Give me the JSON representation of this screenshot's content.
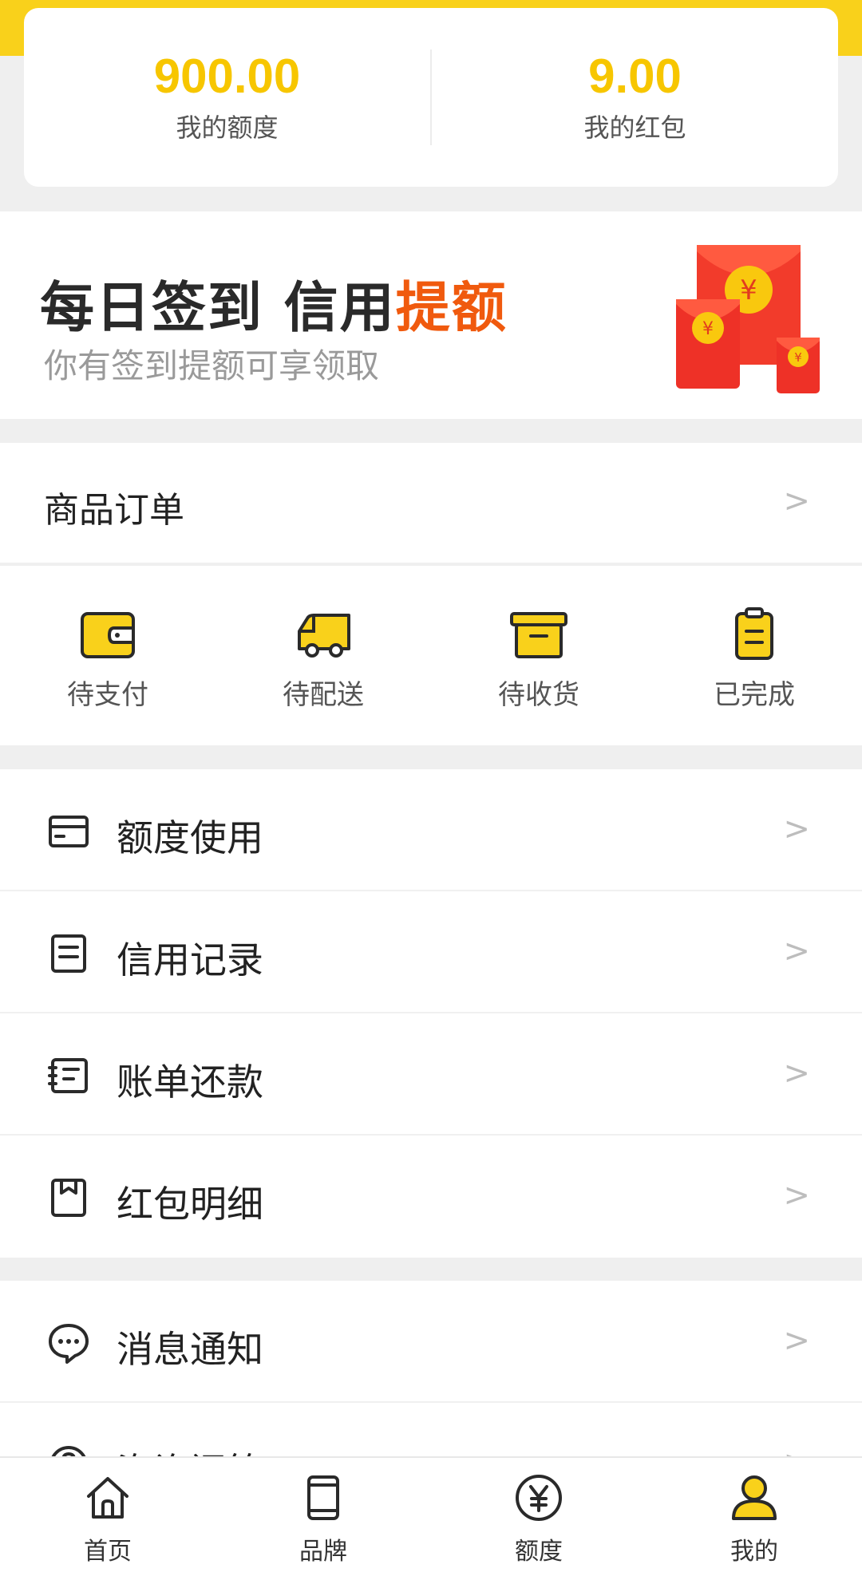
{
  "colors": {
    "brand_yellow": "#f9d11b",
    "highlight_orange": "#f05a0e"
  },
  "stats": {
    "quota_value": "900.00",
    "quota_label": "我的额度",
    "redpack_value": "9.00",
    "redpack_label": "我的红包"
  },
  "signin": {
    "title_main": "每日签到 信用",
    "title_highlight": "提额",
    "subtitle": "你有签到提额可享领取",
    "currency_symbol": "¥"
  },
  "orders": {
    "title": "商品订单",
    "chevron": ">",
    "statuses": [
      {
        "label": "待支付",
        "icon": "wallet-icon"
      },
      {
        "label": "待配送",
        "icon": "truck-icon"
      },
      {
        "label": "待收货",
        "icon": "box-icon"
      },
      {
        "label": "已完成",
        "icon": "clipboard-icon"
      }
    ]
  },
  "menu_group1": [
    {
      "label": "额度使用",
      "icon": "card-icon"
    },
    {
      "label": "信用记录",
      "icon": "document-icon"
    },
    {
      "label": "账单还款",
      "icon": "bill-icon"
    },
    {
      "label": "红包明细",
      "icon": "redpack-icon"
    }
  ],
  "menu_group2": [
    {
      "label": "消息通知",
      "icon": "chat-bubble-icon"
    },
    {
      "label": "咨询问答",
      "icon": "help-icon"
    }
  ],
  "tabbar": [
    {
      "label": "首页",
      "icon": "home-icon"
    },
    {
      "label": "品牌",
      "icon": "tablet-icon"
    },
    {
      "label": "额度",
      "icon": "yen-circle-icon"
    },
    {
      "label": "我的",
      "icon": "person-icon",
      "active": true
    }
  ]
}
